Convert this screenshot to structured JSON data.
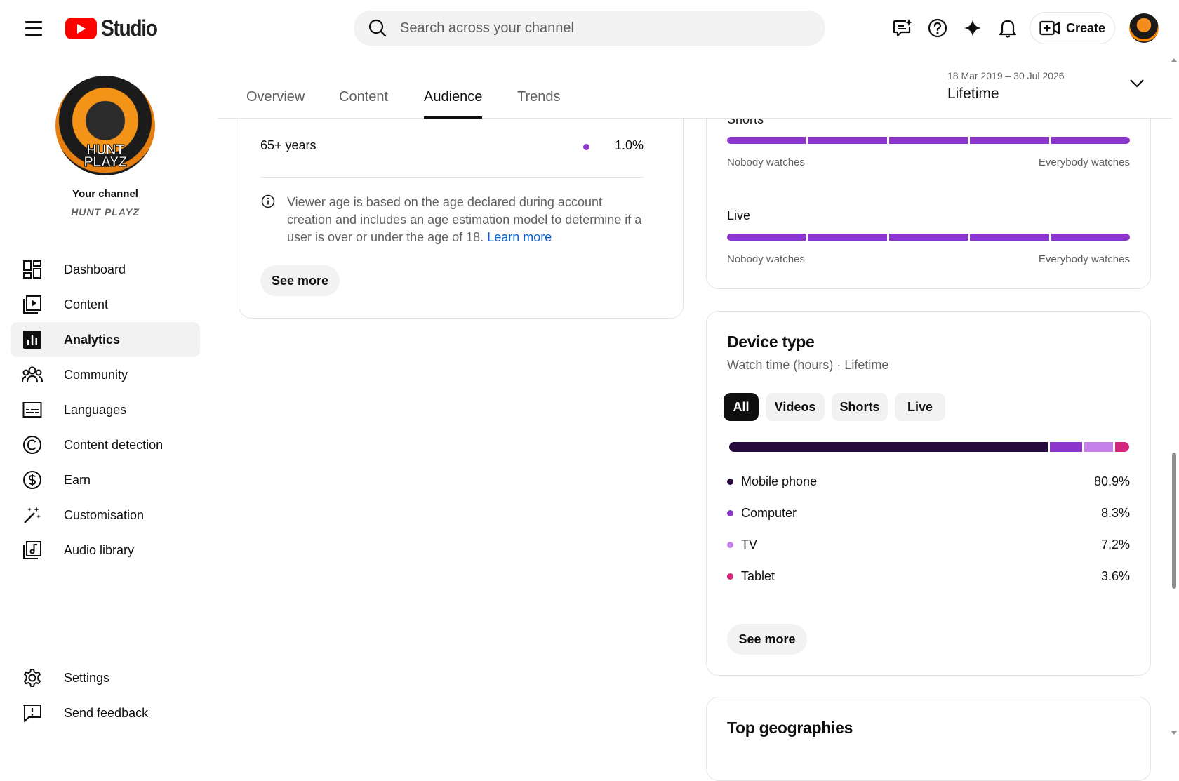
{
  "app": {
    "logo_text": "Studio"
  },
  "search": {
    "placeholder": "Search across your channel"
  },
  "header": {
    "create_label": "Create"
  },
  "channel": {
    "label": "Your channel",
    "name": "HUNT PLAYZ",
    "avatar_text_line1": "HUNT",
    "avatar_text_line2": "PLAYZ"
  },
  "sidebar": {
    "items": [
      {
        "label": "Dashboard",
        "icon": "dashboard-icon"
      },
      {
        "label": "Content",
        "icon": "content-icon"
      },
      {
        "label": "Analytics",
        "icon": "analytics-icon",
        "active": true
      },
      {
        "label": "Community",
        "icon": "community-icon"
      },
      {
        "label": "Languages",
        "icon": "subtitles-icon"
      },
      {
        "label": "Content detection",
        "icon": "copyright-icon"
      },
      {
        "label": "Earn",
        "icon": "dollar-icon"
      },
      {
        "label": "Customisation",
        "icon": "magic-wand-icon"
      },
      {
        "label": "Audio library",
        "icon": "audio-library-icon"
      }
    ],
    "bottom": [
      {
        "label": "Settings",
        "icon": "gear-icon"
      },
      {
        "label": "Send feedback",
        "icon": "feedback-icon"
      }
    ]
  },
  "tabs": [
    {
      "label": "Overview"
    },
    {
      "label": "Content"
    },
    {
      "label": "Audience",
      "active": true
    },
    {
      "label": "Trends"
    }
  ],
  "date_range": {
    "range": "18 Mar 2019 – 30 Jul 2026",
    "label": "Lifetime"
  },
  "age_card": {
    "row": {
      "label": "65+ years",
      "value": "1.0%"
    },
    "info_text": "Viewer age is based on the age declared during account creation and includes an age estimation model to determine if a user is over or under the age of 18.",
    "info_link": "Learn more",
    "see_more": "See more"
  },
  "retention_card": {
    "shorts_label": "Shorts",
    "live_label": "Live",
    "low_end": "Nobody watches",
    "high_end": "Everybody watches",
    "segments": 5
  },
  "device_card": {
    "title": "Device type",
    "subtitle": "Watch time (hours) · Lifetime",
    "chips": [
      {
        "label": "All",
        "active": true
      },
      {
        "label": "Videos"
      },
      {
        "label": "Shorts"
      },
      {
        "label": "Live"
      }
    ],
    "see_more": "See more"
  },
  "chart_data": {
    "type": "bar",
    "categories": [
      "Mobile phone",
      "Computer",
      "TV",
      "Tablet"
    ],
    "values": [
      80.9,
      8.3,
      7.2,
      3.6
    ],
    "value_labels": [
      "80.9%",
      "8.3%",
      "7.2%",
      "3.6%"
    ],
    "colors": [
      "#270a3d",
      "#8c35cc",
      "#c77fec",
      "#d4267c"
    ],
    "orientation": "stacked-horizontal"
  },
  "geo_card": {
    "title": "Top geographies"
  },
  "colors": {
    "accent": "#8c35cc",
    "link": "#065fd4",
    "brand": "#ff0000"
  }
}
